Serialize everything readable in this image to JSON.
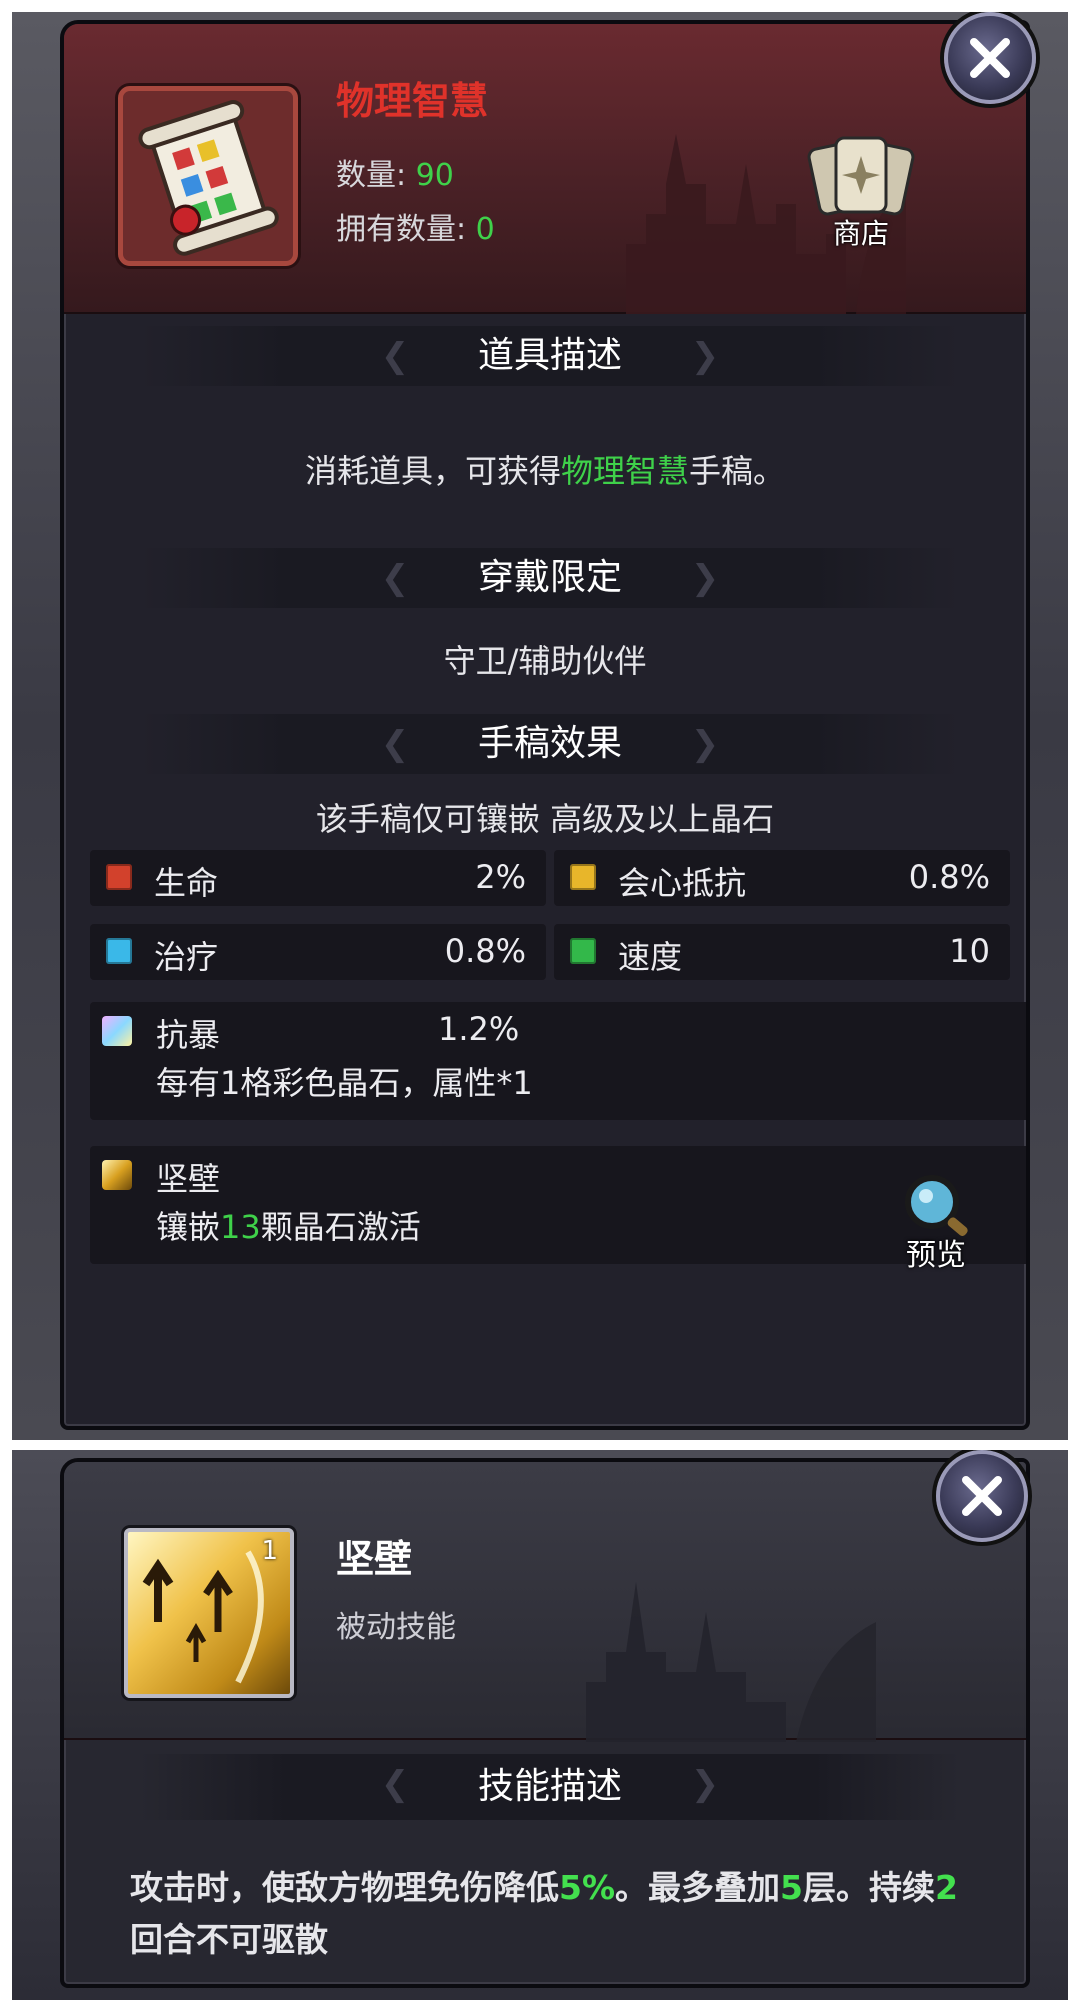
{
  "item_panel": {
    "item_name": "物理智慧",
    "quantity_label": "数量:",
    "quantity_value": "90",
    "owned_label": "拥有数量:",
    "owned_value": "0",
    "shop_label": "商店",
    "section_desc_title": "道具描述",
    "desc_prefix": "消耗道具，可获得",
    "desc_highlight": "物理智慧",
    "desc_suffix": "手稿。",
    "section_wear_title": "穿戴限定",
    "wear_text": "守卫/辅助伙伴",
    "section_effect_title": "手稿效果",
    "effect_note": "该手稿仅可镶嵌 高级及以上晶石",
    "stats": [
      {
        "label": "生命",
        "value": "2%",
        "gem_color": "#d2412c"
      },
      {
        "label": "会心抵抗",
        "value": "0.8%",
        "gem_color": "#e8b62a"
      },
      {
        "label": "治疗",
        "value": "0.8%",
        "gem_color": "#3ab8e8"
      },
      {
        "label": "速度",
        "value": "10",
        "gem_color": "#33b84a"
      }
    ],
    "rainbow_stat": {
      "label": "抗暴",
      "value": "1.2%",
      "note": "每有1格彩色晶石，属性*1"
    },
    "skill_row": {
      "name": "坚壁",
      "text_prefix": "镶嵌",
      "text_count": "13",
      "text_suffix": "颗晶石激活",
      "preview_label": "预览"
    },
    "icons": {
      "close": "close-icon",
      "shop": "shop-icon",
      "scroll": "scroll-icon",
      "preview": "magnifier-icon"
    }
  },
  "skill_panel": {
    "skill_name": "坚壁",
    "skill_level": "1",
    "skill_type": "被动技能",
    "section_title": "技能描述",
    "desc_parts": [
      {
        "text": "攻击时，使敌方物理免伤降低",
        "hl": false
      },
      {
        "text": "5%",
        "hl": true
      },
      {
        "text": "。最多叠加",
        "hl": false
      },
      {
        "text": "5",
        "hl": true
      },
      {
        "text": "层。持续",
        "hl": false
      },
      {
        "text": "2",
        "hl": true
      },
      {
        "text": "回合不可驱散",
        "hl": false
      }
    ]
  },
  "colors": {
    "name_red": "#e0322a",
    "highlight_green": "#3fd14a"
  }
}
